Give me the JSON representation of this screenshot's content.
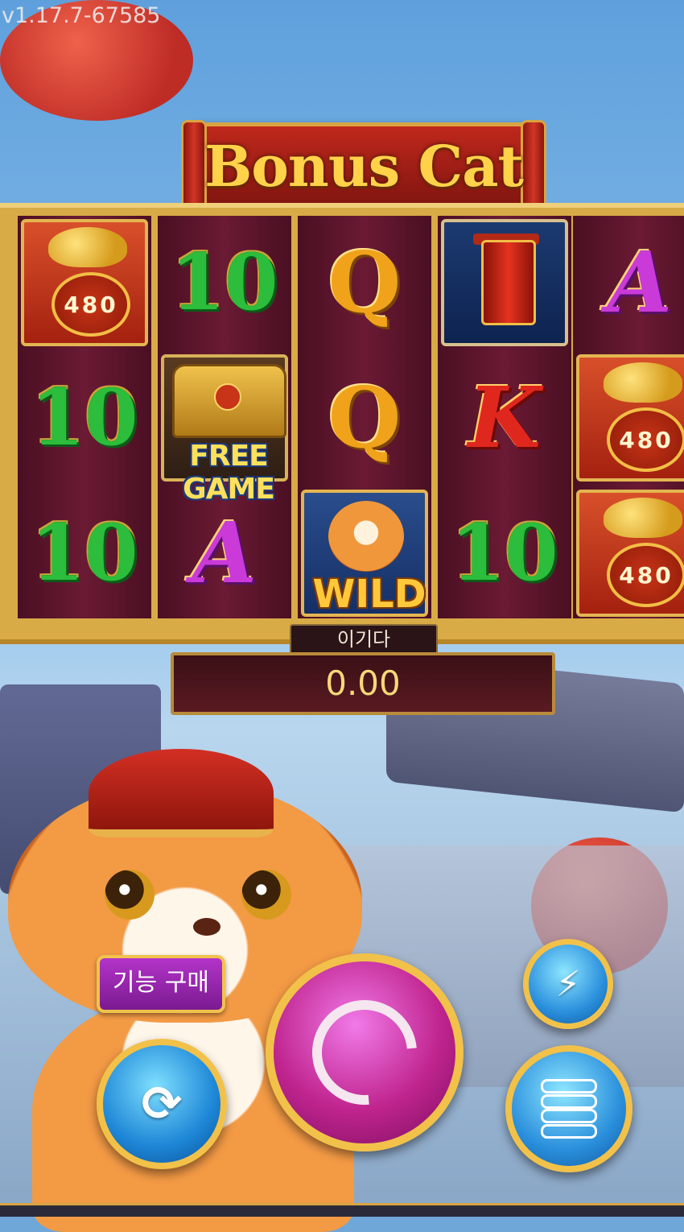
{
  "version": "v1.17.7-67585",
  "game": {
    "title": "Bonus Cat"
  },
  "reels": [
    [
      {
        "type": "envelope",
        "value": "480"
      },
      {
        "type": "letter",
        "glyph": "10",
        "style": "sym-10"
      },
      {
        "type": "letter",
        "glyph": "10",
        "style": "sym-10"
      }
    ],
    [
      {
        "type": "letter",
        "glyph": "10",
        "style": "sym-10"
      },
      {
        "type": "free",
        "label": "FREE GAME"
      },
      {
        "type": "letter",
        "glyph": "A",
        "style": "sym-A"
      }
    ],
    [
      {
        "type": "letter",
        "glyph": "Q",
        "style": "sym-Q"
      },
      {
        "type": "letter",
        "glyph": "Q",
        "style": "sym-Q"
      },
      {
        "type": "wild",
        "label": "WILD"
      }
    ],
    [
      {
        "type": "lantern"
      },
      {
        "type": "letter",
        "glyph": "K",
        "style": "sym-K"
      },
      {
        "type": "letter",
        "glyph": "10",
        "style": "sym-10"
      }
    ],
    [
      {
        "type": "letter",
        "glyph": "A",
        "style": "sym-A"
      },
      {
        "type": "envelope",
        "value": "480"
      },
      {
        "type": "envelope",
        "value": "480"
      }
    ]
  ],
  "win": {
    "label": "이기다",
    "amount": "0.00"
  },
  "controls": {
    "feature_buy_label": "기능 구매",
    "spin_icon": "spin-icon",
    "auto_icon": "autoplay-icon",
    "turbo_icon": "turbo-paw-icon",
    "bet_icon": "coin-stack-icon"
  },
  "colors": {
    "accent_gold": "#f1c14a",
    "reel_bg": "#6b1a34",
    "spin_purple": "#c0248e",
    "button_blue": "#2a8fdc"
  }
}
